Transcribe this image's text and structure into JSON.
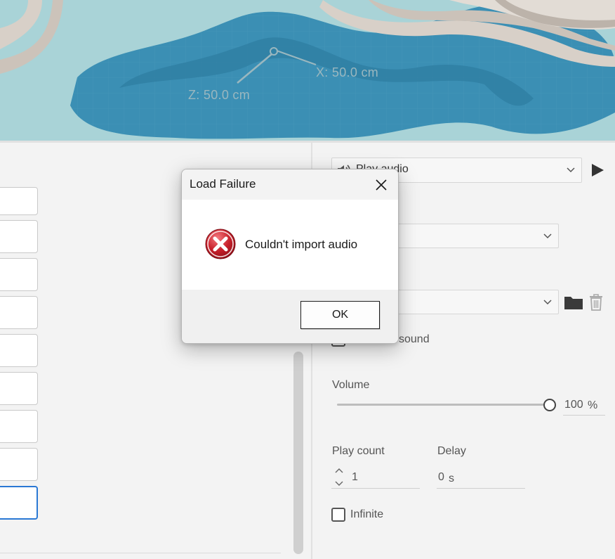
{
  "viewport": {
    "axis_x_label": "X:  50.0 cm",
    "axis_z_label": "Z:  50.0 cm",
    "colors": {
      "water": "#3b8fb4",
      "land": "#a9d3d7",
      "walls": "#d8d0c8"
    }
  },
  "audio": {
    "action_dropdown_value": "Play audio",
    "action_icon": "speaker-icon",
    "play_icon": "play-icon",
    "checkbox_label_partial": "sound",
    "volume_label": "Volume",
    "volume_value": "100",
    "volume_unit": "%",
    "volume_level_percent": 100,
    "play_count_label": "Play count",
    "play_count_value": "1",
    "delay_label": "Delay",
    "delay_value": "0",
    "delay_unit": "s",
    "infinite_label": "Infinite",
    "folder_icon": "folder-icon",
    "trash_icon": "trash-icon"
  },
  "dialog": {
    "title": "Load Failure",
    "message": "Couldn't import audio",
    "ok_label": "OK",
    "icon": "error-icon",
    "colors": {
      "error_red": "#c8202b",
      "focus_blue": "#2a78d4"
    }
  }
}
